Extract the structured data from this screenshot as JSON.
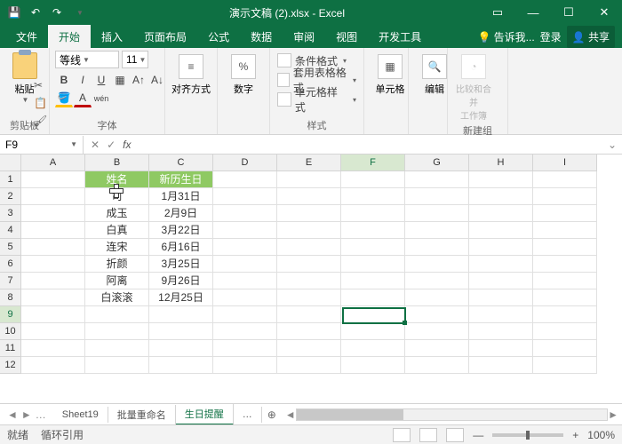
{
  "title": "演示文稿 (2).xlsx - Excel",
  "tabs": {
    "file": "文件",
    "home": "开始",
    "insert": "插入",
    "layout": "页面布局",
    "formula": "公式",
    "data": "数据",
    "review": "审阅",
    "view": "视图",
    "dev": "开发工具"
  },
  "tell": "告诉我...",
  "login": "登录",
  "share": "共享",
  "ribbon": {
    "paste": "粘贴",
    "clipboard": "剪贴板",
    "font_name": "等线",
    "font_size": "11",
    "font": "字体",
    "align": "对齐方式",
    "number": "数字",
    "styles": "样式",
    "cond": "条件格式",
    "tablefmt": "套用表格格式",
    "cellfmt": "单元格样式",
    "cells": "单元格",
    "edit": "编辑",
    "compare": "比较和合并\n工作簿",
    "newgroup": "新建组"
  },
  "namebox": "F9",
  "cols": [
    "A",
    "B",
    "C",
    "D",
    "E",
    "F",
    "G",
    "H",
    "I"
  ],
  "rows": [
    "1",
    "2",
    "3",
    "4",
    "5",
    "6",
    "7",
    "8",
    "9",
    "10",
    "11",
    "12"
  ],
  "header": {
    "b": "姓名",
    "c": "新历生日"
  },
  "data": [
    {
      "b": "司",
      "c": "1月31日"
    },
    {
      "b": "成玉",
      "c": "2月9日"
    },
    {
      "b": "白真",
      "c": "3月22日"
    },
    {
      "b": "连宋",
      "c": "6月16日"
    },
    {
      "b": "折颜",
      "c": "3月25日"
    },
    {
      "b": "阿离",
      "c": "9月26日"
    },
    {
      "b": "白滚滚",
      "c": "12月25日"
    }
  ],
  "sheets": {
    "s1": "Sheet19",
    "s2": "批量重命名",
    "s3": "生日提醒"
  },
  "status": {
    "ready": "就绪",
    "circ": "循环引用",
    "zoom": "100%"
  }
}
